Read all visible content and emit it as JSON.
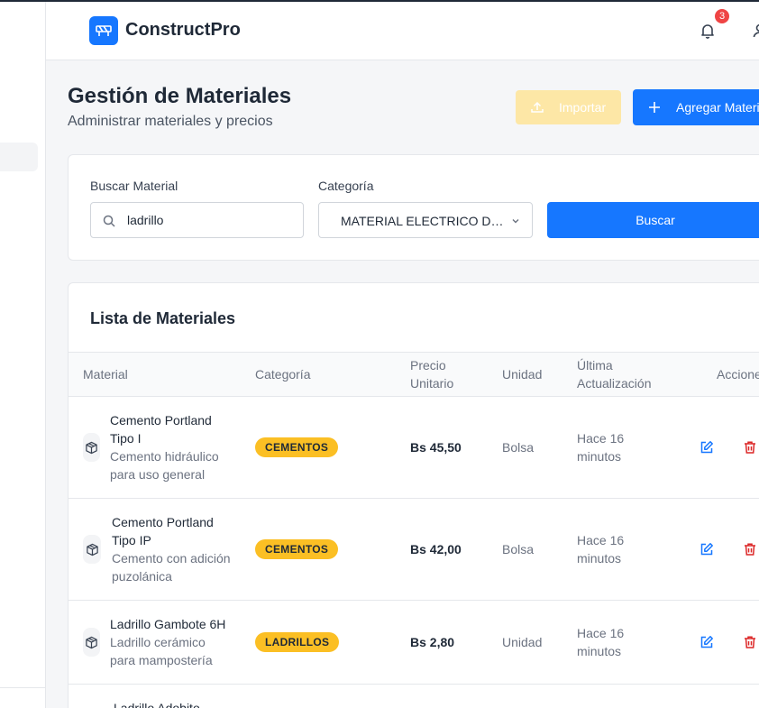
{
  "app": {
    "brand": "ConstructPro",
    "notifications_count": "3"
  },
  "page": {
    "title": "Gestión de Materiales",
    "subtitle": "Administrar materiales y precios"
  },
  "actions": {
    "import_label": "Importar",
    "add_label": "Agregar Material"
  },
  "filters": {
    "search_label": "Buscar Material",
    "search_value": "ladrillo",
    "category_label": "Categoría",
    "category_value": "MATERIAL ELECTRICO DOMICILIARIO",
    "search_button": "Buscar"
  },
  "list": {
    "title": "Lista de Materiales",
    "columns": {
      "material": "Material",
      "category": "Categoría",
      "price": "Precio Unitario",
      "unit": "Unidad",
      "updated": "Última Actualización",
      "actions": "Acciones"
    },
    "rows": [
      {
        "name": "Cemento Portland Tipo I",
        "description": "Cemento hidráulico para uso general",
        "category": "CEMENTOS",
        "price": "Bs 45,50",
        "unit": "Bolsa",
        "updated": "Hace 16 minutos"
      },
      {
        "name": "Cemento Portland Tipo IP",
        "description": "Cemento con adición puzolánica",
        "category": "CEMENTOS",
        "price": "Bs 42,00",
        "unit": "Bolsa",
        "updated": "Hace 16 minutos"
      },
      {
        "name": "Ladrillo Gambote 6H",
        "description": "Ladrillo cerámico para mampostería",
        "category": "LADRILLOS",
        "price": "Bs 2,80",
        "unit": "Unidad",
        "updated": "Hace 16 minutos"
      },
      {
        "name": "Ladrillo Adobito",
        "description": "",
        "category": "",
        "price": "",
        "unit": "",
        "updated": ""
      }
    ]
  },
  "colors": {
    "primary": "#1677ff",
    "badge": "#fbbf24",
    "danger": "#dc2626",
    "import_disabled": "#fde7a6"
  }
}
